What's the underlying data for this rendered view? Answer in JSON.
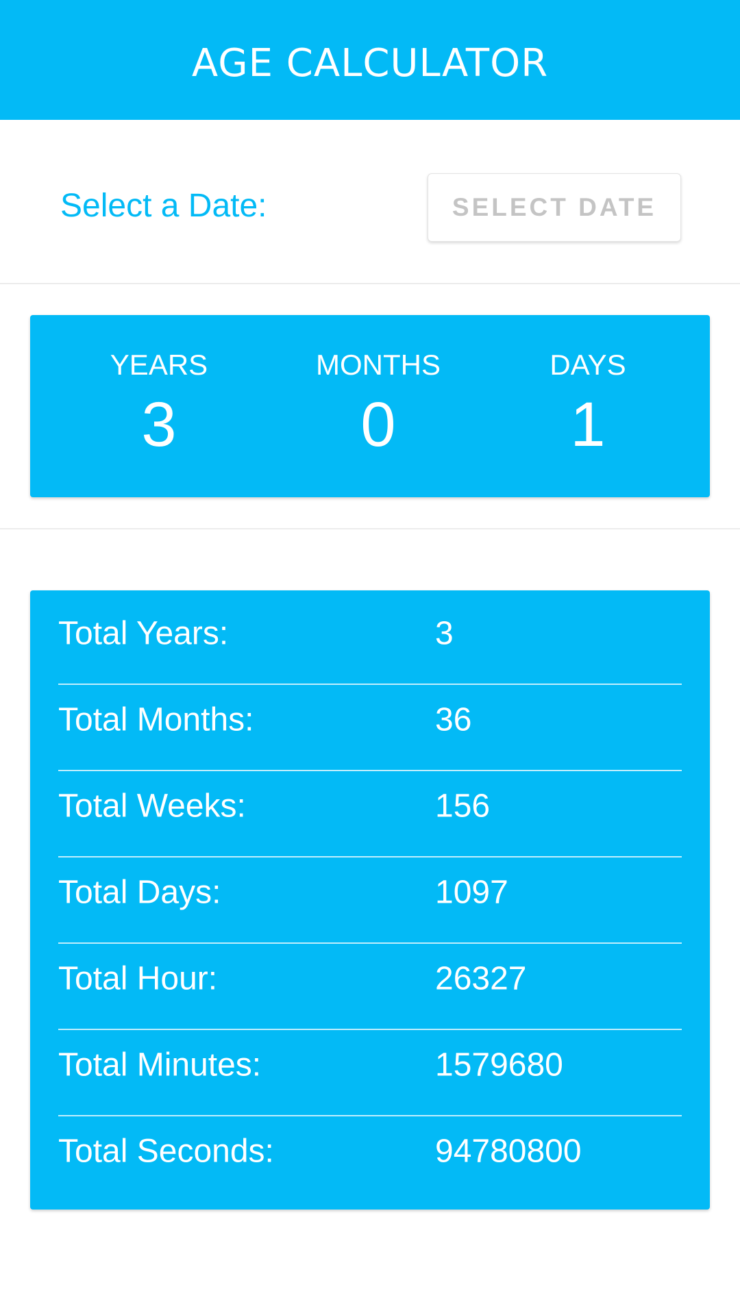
{
  "header": {
    "title": "AGE CALCULATOR"
  },
  "date_picker": {
    "label": "Select a Date:",
    "button_label": "SELECT DATE"
  },
  "summary": {
    "years_label": "YEARS",
    "years_value": "3",
    "months_label": "MONTHS",
    "months_value": "0",
    "days_label": "DAYS",
    "days_value": "1"
  },
  "totals": [
    {
      "label": "Total Years:",
      "value": "3"
    },
    {
      "label": "Total Months:",
      "value": "36"
    },
    {
      "label": "Total Weeks:",
      "value": "156"
    },
    {
      "label": "Total Days:",
      "value": "1097"
    },
    {
      "label": "Total Hour:",
      "value": "26327"
    },
    {
      "label": "Total Minutes:",
      "value": "1579680"
    },
    {
      "label": "Total Seconds:",
      "value": "94780800"
    }
  ],
  "colors": {
    "accent": "#03BAF6",
    "button_text": "#C4C4C4",
    "background": "#FFFFFF"
  }
}
